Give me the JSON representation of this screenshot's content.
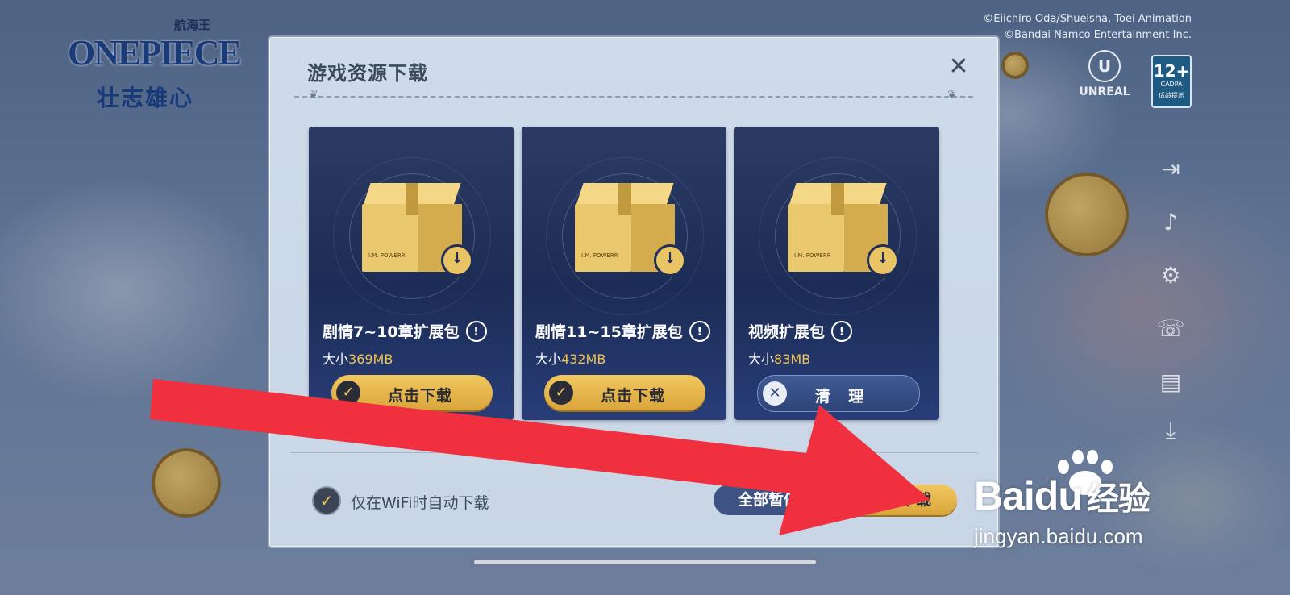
{
  "logo": {
    "sub": "航海王",
    "main": "ONEPIECE",
    "cn": "壮志雄心"
  },
  "copyright": {
    "line1": "©Eiichiro Oda/Shueisha, Toei Animation",
    "line2": "©Bandai Namco Entertainment Inc."
  },
  "unreal": {
    "label": "UNREAL"
  },
  "age_rating": {
    "number": "12+",
    "org": "CADPA",
    "note": "适龄提示"
  },
  "modal": {
    "title": "游戏资源下载",
    "cards": [
      {
        "title": "剧情7~10章扩展包",
        "size_prefix": "大小",
        "size_value": "369MB",
        "button": "点击下载",
        "box_label": "I.M. POWERR"
      },
      {
        "title": "剧情11~15章扩展包",
        "size_prefix": "大小",
        "size_value": "432MB",
        "button": "点击下载",
        "box_label": "I.M. POWERR"
      },
      {
        "title": "视频扩展包",
        "size_prefix": "大小",
        "size_value": "83MB",
        "button": "清 理",
        "box_label": "I.M. POWERR"
      }
    ],
    "wifi_label": "仅在WiFi时自动下载",
    "wifi_checked": true,
    "pause_all": "全部暂停",
    "download_all": "全部下载"
  },
  "watermark": {
    "brand": "Baidu",
    "cn": "经验",
    "url": "jingyan.baidu.com"
  },
  "colors": {
    "accent": "#f1c24f",
    "card_bg": "#1c2c55",
    "arrow": "#f0303f"
  }
}
